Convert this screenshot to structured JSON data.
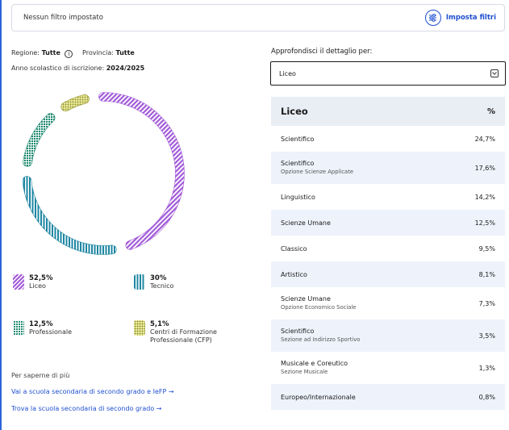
{
  "filter_bar": {
    "status_text": "Nessun filtro impostato",
    "button_label": "Imposta filtri",
    "button_icon": "sliders-icon"
  },
  "meta": {
    "region_label": "Regione:",
    "region_value": "Tutte",
    "province_label": "Provincia:",
    "province_value": "Tutte",
    "year_label": "Anno scolastico di iscrizione:",
    "year_value": "2024/2025"
  },
  "chart_data": {
    "type": "donut",
    "series": [
      {
        "name": "Liceo",
        "value": 52.5,
        "color": "#a25ad8",
        "pattern": "diagonal-stripes"
      },
      {
        "name": "Tecnico",
        "value": 30,
        "color": "#1e86a3",
        "pattern": "vertical-stripes"
      },
      {
        "name": "Professionale",
        "value": 12.5,
        "color": "#1f8a70",
        "pattern": "grid"
      },
      {
        "name": "Centri di Formazione Professionale (CFP)",
        "value": 5.1,
        "color": "#8f8f2e",
        "pattern": "dots"
      }
    ]
  },
  "legend": [
    {
      "value": "52,5%",
      "label": "Liceo"
    },
    {
      "value": "30%",
      "label": "Tecnico"
    },
    {
      "value": "12,5%",
      "label": "Professionale"
    },
    {
      "value": "5,1%",
      "label_line1": "Centri di Formazione",
      "label_line2": "Professionale (CFP)"
    }
  ],
  "links": {
    "heading": "Per saperne di più",
    "items": [
      "Vai a scuola secondaria di secondo grado e IeFP →",
      "Trova la scuola secondaria di secondo grado →"
    ]
  },
  "detail": {
    "title": "Approfondisci il dettaglio per:",
    "selected": "Liceo",
    "table_header": {
      "name": "Liceo",
      "pct": "%"
    },
    "rows": [
      {
        "name": "Scientifico",
        "sub": "",
        "pct": "24,7%"
      },
      {
        "name": "Scientifico",
        "sub": "Opzione Scienze Applicate",
        "pct": "17,6%"
      },
      {
        "name": "Linguistico",
        "sub": "",
        "pct": "14,2%"
      },
      {
        "name": "Scienze Umane",
        "sub": "",
        "pct": "12,5%"
      },
      {
        "name": "Classico",
        "sub": "",
        "pct": "9,5%"
      },
      {
        "name": "Artistico",
        "sub": "",
        "pct": "8,1%"
      },
      {
        "name": "Scienze Umane",
        "sub": "Opzione Economico Sociale",
        "pct": "7,3%"
      },
      {
        "name": "Scientifico",
        "sub": "Sezione ad Indirizzo Sportivo",
        "pct": "3,5%"
      },
      {
        "name": "Musicale e Coreutico",
        "sub": "Sezione Musicale",
        "pct": "1,3%"
      },
      {
        "name": "Europeo/Internazionale",
        "sub": "",
        "pct": "0,8%"
      }
    ]
  }
}
